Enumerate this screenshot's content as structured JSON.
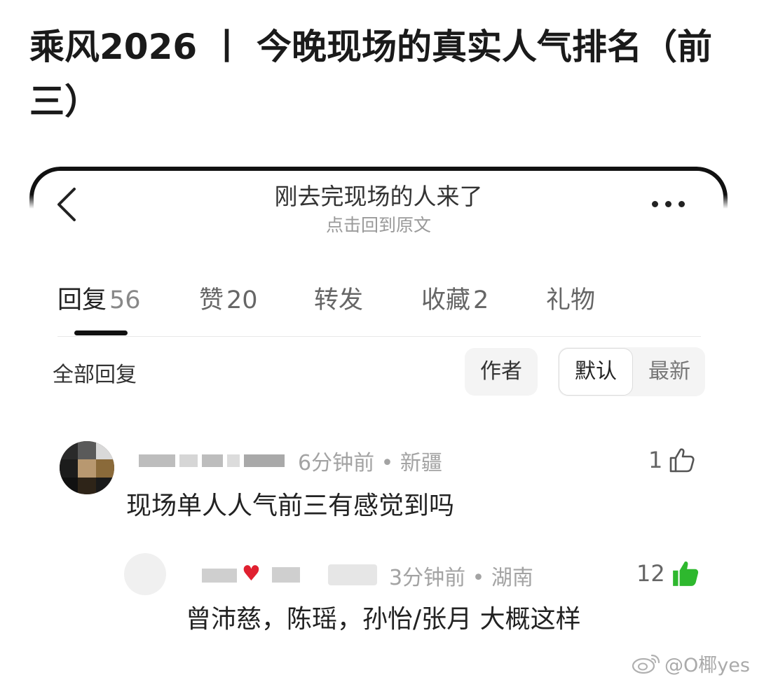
{
  "headline": "乘风2026 丨 今晚现场的真实人气排名（前三）",
  "nav": {
    "title": "刚去完现场的人来了",
    "subtitle": "点击回到原文"
  },
  "tabs": [
    {
      "label": "回复",
      "count": "56"
    },
    {
      "label": "赞",
      "count": "20"
    },
    {
      "label": "转发",
      "count": ""
    },
    {
      "label": "收藏",
      "count": "2"
    },
    {
      "label": "礼物",
      "count": ""
    }
  ],
  "filters": {
    "all_replies": "全部回复",
    "author": "作者",
    "default": "默认",
    "latest": "最新"
  },
  "comments": [
    {
      "time_location": "6分钟前 • 新疆",
      "likes": "1",
      "liked": false,
      "text": "现场单人人气前三有感觉到吗"
    },
    {
      "time_location": "3分钟前 • 湖南",
      "likes": "12",
      "liked": true,
      "text": "曾沛慈，陈瑶，孙怡/张月 大概这样"
    }
  ],
  "watermark": "@O椰yes",
  "colors": {
    "like_active": "#2eb82e",
    "heart": "#e02030",
    "meta_text": "#a3a3a3"
  },
  "icons": {
    "back": "chevron-left-icon",
    "more": "more-dots-icon",
    "like": "thumbs-up-icon",
    "heart": "heart-icon",
    "weibo": "weibo-logo-icon"
  }
}
